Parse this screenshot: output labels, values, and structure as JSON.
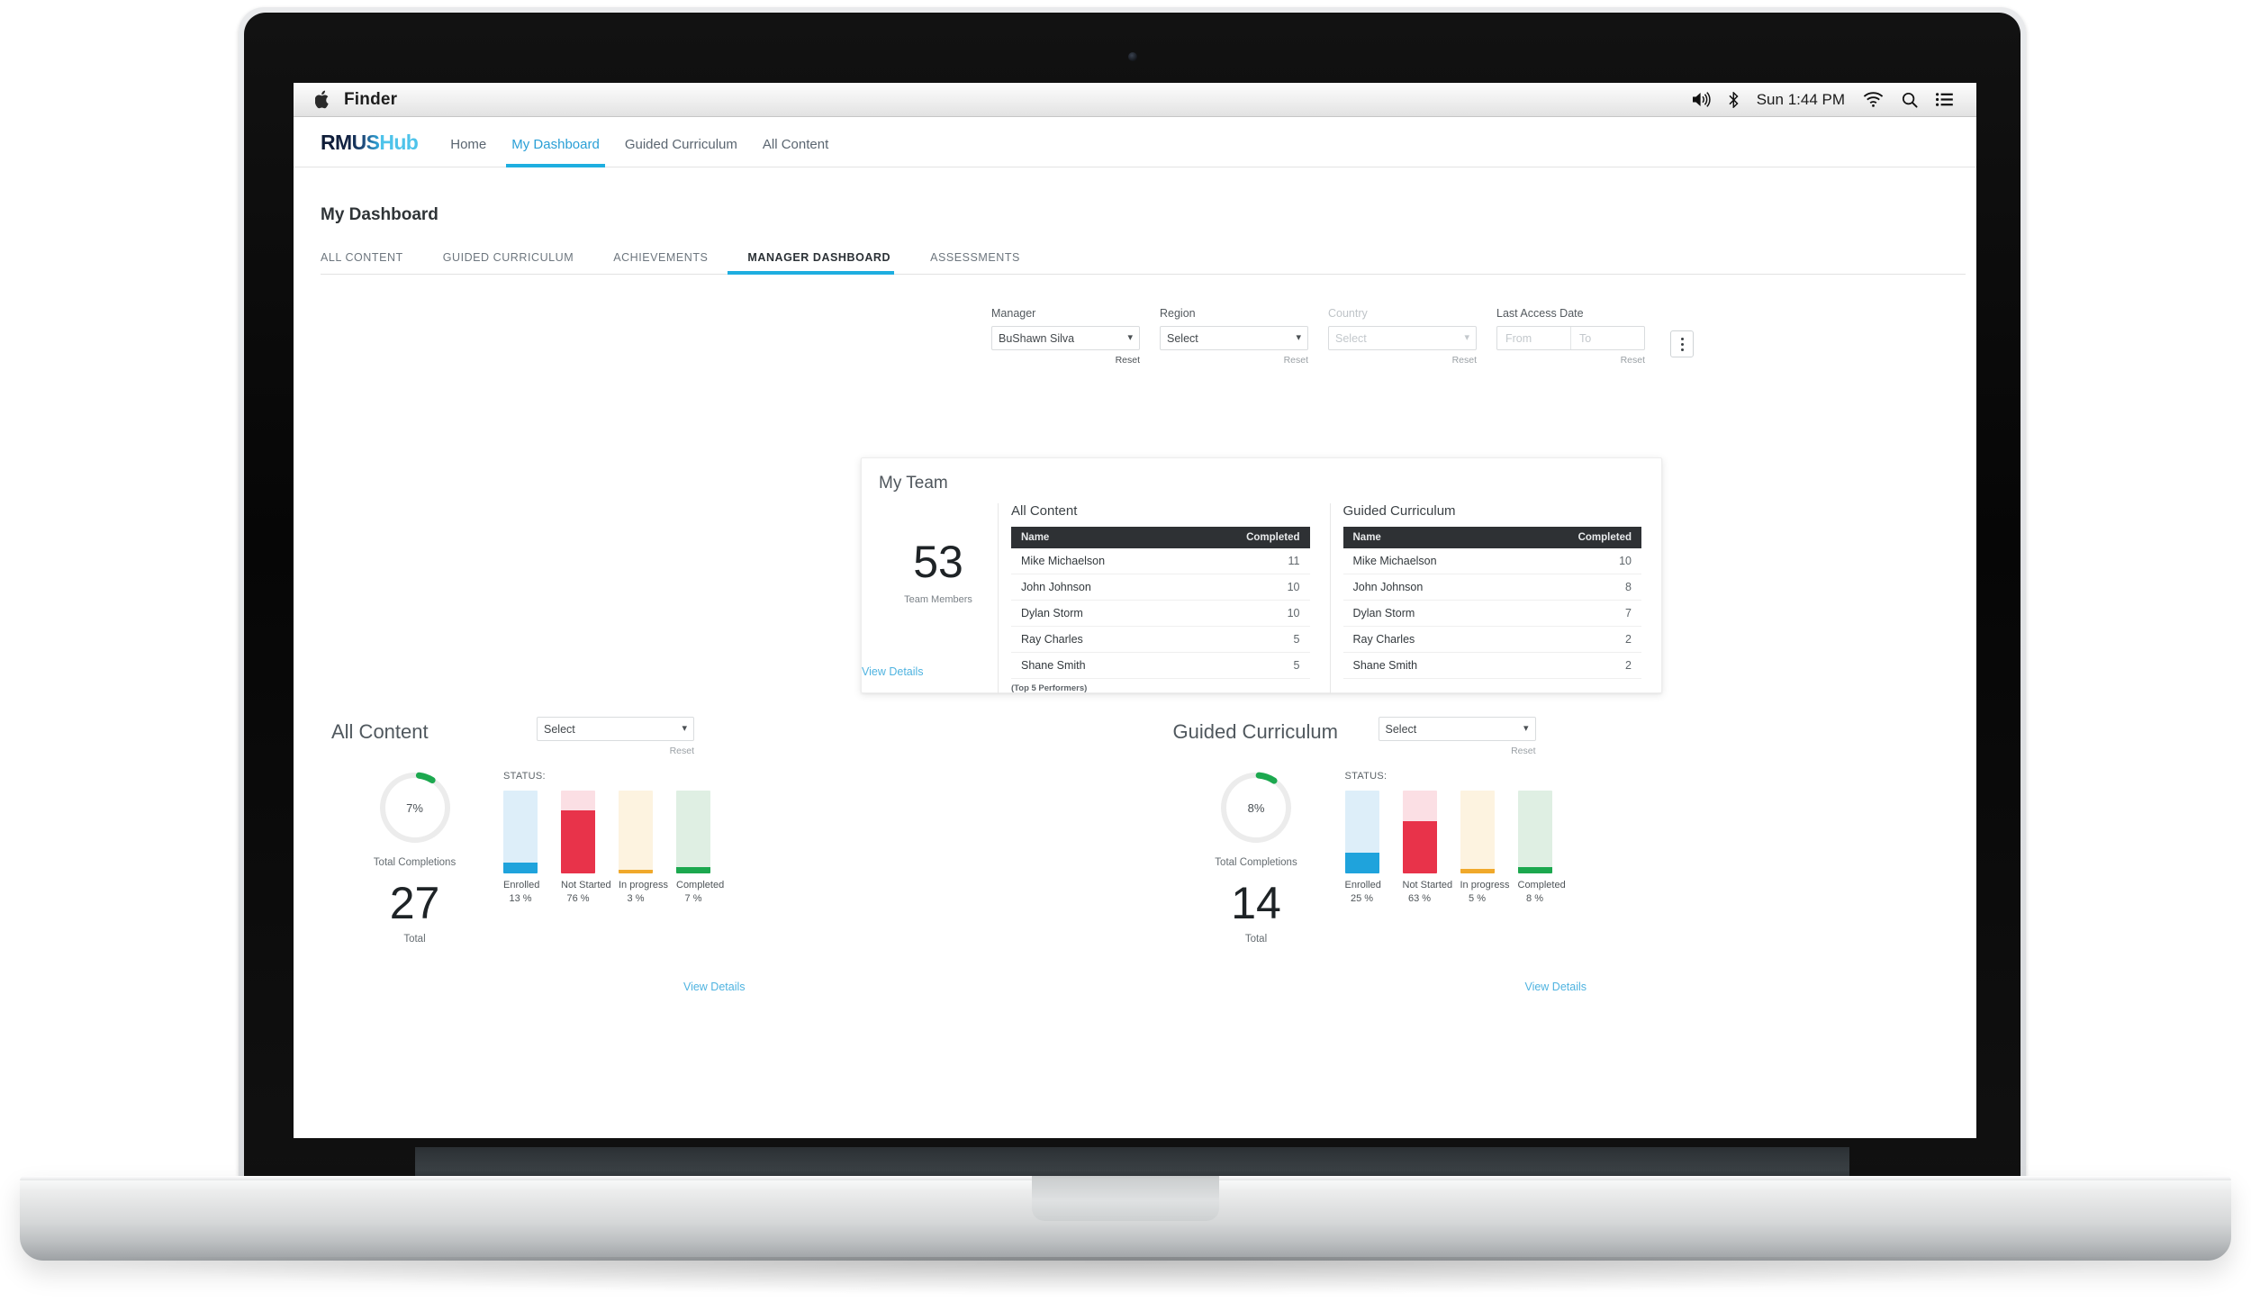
{
  "os_menubar": {
    "app_name": "Finder",
    "clock": "Sun 1:44 PM",
    "icons": [
      "apple-logo-icon",
      "volume-icon",
      "bluetooth-icon",
      "wifi-icon",
      "search-icon",
      "list-icon"
    ]
  },
  "appnav": {
    "logo_primary": "RMUS",
    "logo_secondary": "Hub",
    "items": [
      {
        "label": "Home",
        "active": false
      },
      {
        "label": "My Dashboard",
        "active": true
      },
      {
        "label": "Guided Curriculum",
        "active": false
      },
      {
        "label": "All Content",
        "active": false
      }
    ]
  },
  "page": {
    "title": "My Dashboard",
    "subtabs": [
      {
        "label": "ALL CONTENT",
        "active": false
      },
      {
        "label": "GUIDED CURRICULUM",
        "active": false
      },
      {
        "label": "ACHIEVEMENTS",
        "active": false
      },
      {
        "label": "MANAGER DASHBOARD",
        "active": true
      },
      {
        "label": "ASSESSMENTS",
        "active": false
      }
    ]
  },
  "filters": {
    "manager": {
      "label": "Manager",
      "value": "BuShawn Silva",
      "reset": "Reset"
    },
    "region": {
      "label": "Region",
      "value": "Select",
      "reset": "Reset"
    },
    "country": {
      "label": "Country",
      "value": "Select",
      "reset": "Reset"
    },
    "last_access_date": {
      "label": "Last Access Date",
      "from_placeholder": "From",
      "to_placeholder": "To",
      "reset": "Reset"
    },
    "more_options_icon": "vertical-dots-icon"
  },
  "my_team": {
    "title": "My Team",
    "count": "53",
    "count_label": "Team Members",
    "top5_note": "(Top 5 Performers)",
    "view_details": "View Details",
    "columns": [
      {
        "title": "All Content",
        "headers": [
          "Name",
          "Completed"
        ],
        "rows": [
          {
            "name": "Mike Michaelson",
            "completed": "11"
          },
          {
            "name": "John Johnson",
            "completed": "10"
          },
          {
            "name": "Dylan Storm",
            "completed": "10"
          },
          {
            "name": "Ray Charles",
            "completed": "5"
          },
          {
            "name": "Shane Smith",
            "completed": "5"
          }
        ]
      },
      {
        "title": "Guided Curriculum",
        "headers": [
          "Name",
          "Completed"
        ],
        "rows": [
          {
            "name": "Mike Michaelson",
            "completed": "10"
          },
          {
            "name": "John Johnson",
            "completed": "8"
          },
          {
            "name": "Dylan Storm",
            "completed": "7"
          },
          {
            "name": "Ray Charles",
            "completed": "2"
          },
          {
            "name": "Shane Smith",
            "completed": "2"
          }
        ]
      }
    ]
  },
  "panels": [
    {
      "title": "All Content",
      "select_value": "Select",
      "reset": "Reset",
      "donut_pct": "7%",
      "donut_label": "Total Completions",
      "total": "27",
      "total_label": "Total",
      "status_label": "STATUS:",
      "view_details": "View Details"
    },
    {
      "title": "Guided Curriculum",
      "select_value": "Select",
      "reset": "Reset",
      "donut_pct": "8%",
      "donut_label": "Total Completions",
      "total": "14",
      "total_label": "Total",
      "status_label": "STATUS:",
      "view_details": "View Details"
    }
  ],
  "colors": {
    "accent": "#1eaee0",
    "link": "#4fb3e0",
    "logo_hub": "#4ec3ea",
    "table_header_bg": "#2e3134",
    "enrolled": "#1fa3dc",
    "not_started": "#e8334a",
    "in_progress": "#f0a92b",
    "completed": "#1ca84f",
    "enrolled_track": "#ddeef9",
    "not_started_track": "#fbdfe4",
    "in_progress_track": "#fdf3e0",
    "completed_track": "#dfefe3"
  },
  "chart_data": [
    {
      "type": "bar",
      "title": "All Content",
      "subtitle": "STATUS:",
      "categories": [
        "Enrolled",
        "Not Started",
        "In progress",
        "Completed"
      ],
      "values": [
        13,
        76,
        3,
        7
      ],
      "value_labels": [
        "13 %",
        "76 %",
        "3 %",
        "7 %"
      ],
      "unit": "%",
      "ylim": [
        0,
        100
      ],
      "grid": false,
      "legend": "none",
      "series_colors": [
        "#1fa3dc",
        "#e8334a",
        "#f0a92b",
        "#1ca84f"
      ],
      "track_colors": [
        "#ddeef9",
        "#fbdfe4",
        "#fdf3e0",
        "#dfefe3"
      ],
      "donut": {
        "type": "pie",
        "label": "Total Completions",
        "value": 7,
        "display": "7%",
        "remainder": 93,
        "color": "#1ca84f",
        "track": "#ececec"
      },
      "total": {
        "label": "Total",
        "value": 27
      }
    },
    {
      "type": "bar",
      "title": "Guided Curriculum",
      "subtitle": "STATUS:",
      "categories": [
        "Enrolled",
        "Not Started",
        "In progress",
        "Completed"
      ],
      "values": [
        25,
        63,
        5,
        8
      ],
      "value_labels": [
        "25 %",
        "63 %",
        "5 %",
        "8 %"
      ],
      "unit": "%",
      "ylim": [
        0,
        100
      ],
      "grid": false,
      "legend": "none",
      "series_colors": [
        "#1fa3dc",
        "#e8334a",
        "#f0a92b",
        "#1ca84f"
      ],
      "track_colors": [
        "#ddeef9",
        "#fbdfe4",
        "#fdf3e0",
        "#dfefe3"
      ],
      "donut": {
        "type": "pie",
        "label": "Total Completions",
        "value": 8,
        "display": "8%",
        "remainder": 92,
        "color": "#1ca84f",
        "track": "#ececec"
      },
      "total": {
        "label": "Total",
        "value": 14
      }
    },
    {
      "type": "table",
      "title": "My Team — All Content",
      "columns": [
        "Name",
        "Completed"
      ],
      "rows": [
        [
          "Mike Michaelson",
          11
        ],
        [
          "John Johnson",
          10
        ],
        [
          "Dylan Storm",
          10
        ],
        [
          "Ray Charles",
          5
        ],
        [
          "Shane Smith",
          5
        ]
      ]
    },
    {
      "type": "table",
      "title": "My Team — Guided Curriculum",
      "columns": [
        "Name",
        "Completed"
      ],
      "rows": [
        [
          "Mike Michaelson",
          10
        ],
        [
          "John Johnson",
          8
        ],
        [
          "Dylan Storm",
          7
        ],
        [
          "Ray Charles",
          2
        ],
        [
          "Shane Smith",
          2
        ]
      ]
    }
  ]
}
